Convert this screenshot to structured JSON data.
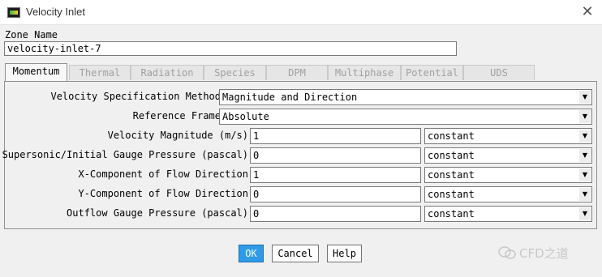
{
  "window": {
    "title": "Velocity Inlet"
  },
  "zone": {
    "label": "Zone Name",
    "value": "velocity-inlet-7"
  },
  "tabs": [
    {
      "label": "Momentum",
      "active": true
    },
    {
      "label": "Thermal"
    },
    {
      "label": "Radiation"
    },
    {
      "label": "Species"
    },
    {
      "label": "DPM"
    },
    {
      "label": "Multiphase"
    },
    {
      "label": "Potential"
    },
    {
      "label": "UDS"
    }
  ],
  "momentum": {
    "method": {
      "label": "Velocity Specification Method",
      "value": "Magnitude and Direction"
    },
    "reference_frame": {
      "label": "Reference Frame",
      "value": "Absolute"
    },
    "velocity_magnitude": {
      "label": "Velocity Magnitude (m/s)",
      "value": "1",
      "profile": "constant"
    },
    "gauge_pressure": {
      "label": "Supersonic/Initial Gauge Pressure (pascal)",
      "value": "0",
      "profile": "constant"
    },
    "x_direction": {
      "label": "X-Component of Flow Direction",
      "value": "1",
      "profile": "constant"
    },
    "y_direction": {
      "label": "Y-Component of Flow Direction",
      "value": "0",
      "profile": "constant"
    },
    "outflow_pressure": {
      "label": "Outflow Gauge Pressure (pascal)",
      "value": "0",
      "profile": "constant"
    }
  },
  "buttons": {
    "ok": "OK",
    "cancel": "Cancel",
    "help": "Help"
  },
  "watermark": {
    "text": "CFD之道"
  },
  "colors": {
    "ok_button": "#2f9be8",
    "panel_bg": "#f0f0f0"
  }
}
